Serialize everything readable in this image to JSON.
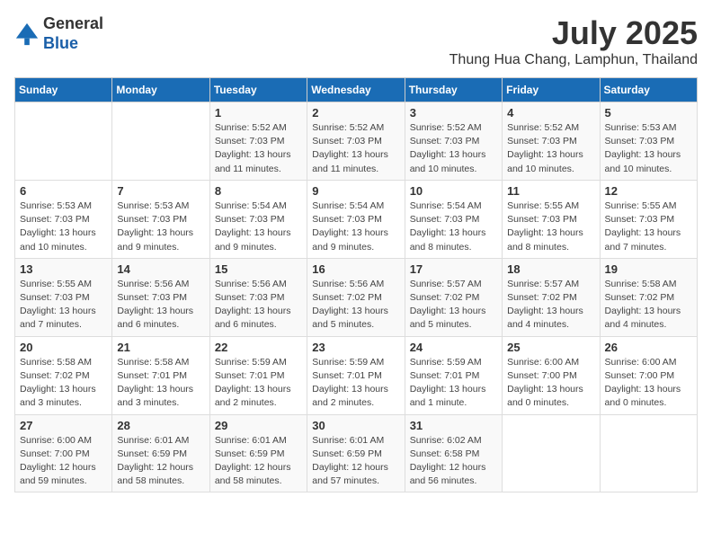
{
  "header": {
    "logo_line1": "General",
    "logo_line2": "Blue",
    "month_year": "July 2025",
    "location": "Thung Hua Chang, Lamphun, Thailand"
  },
  "weekdays": [
    "Sunday",
    "Monday",
    "Tuesday",
    "Wednesday",
    "Thursday",
    "Friday",
    "Saturday"
  ],
  "weeks": [
    [
      {
        "day": "",
        "sunrise": "",
        "sunset": "",
        "daylight": ""
      },
      {
        "day": "",
        "sunrise": "",
        "sunset": "",
        "daylight": ""
      },
      {
        "day": "1",
        "sunrise": "Sunrise: 5:52 AM",
        "sunset": "Sunset: 7:03 PM",
        "daylight": "Daylight: 13 hours and 11 minutes."
      },
      {
        "day": "2",
        "sunrise": "Sunrise: 5:52 AM",
        "sunset": "Sunset: 7:03 PM",
        "daylight": "Daylight: 13 hours and 11 minutes."
      },
      {
        "day": "3",
        "sunrise": "Sunrise: 5:52 AM",
        "sunset": "Sunset: 7:03 PM",
        "daylight": "Daylight: 13 hours and 10 minutes."
      },
      {
        "day": "4",
        "sunrise": "Sunrise: 5:52 AM",
        "sunset": "Sunset: 7:03 PM",
        "daylight": "Daylight: 13 hours and 10 minutes."
      },
      {
        "day": "5",
        "sunrise": "Sunrise: 5:53 AM",
        "sunset": "Sunset: 7:03 PM",
        "daylight": "Daylight: 13 hours and 10 minutes."
      }
    ],
    [
      {
        "day": "6",
        "sunrise": "Sunrise: 5:53 AM",
        "sunset": "Sunset: 7:03 PM",
        "daylight": "Daylight: 13 hours and 10 minutes."
      },
      {
        "day": "7",
        "sunrise": "Sunrise: 5:53 AM",
        "sunset": "Sunset: 7:03 PM",
        "daylight": "Daylight: 13 hours and 9 minutes."
      },
      {
        "day": "8",
        "sunrise": "Sunrise: 5:54 AM",
        "sunset": "Sunset: 7:03 PM",
        "daylight": "Daylight: 13 hours and 9 minutes."
      },
      {
        "day": "9",
        "sunrise": "Sunrise: 5:54 AM",
        "sunset": "Sunset: 7:03 PM",
        "daylight": "Daylight: 13 hours and 9 minutes."
      },
      {
        "day": "10",
        "sunrise": "Sunrise: 5:54 AM",
        "sunset": "Sunset: 7:03 PM",
        "daylight": "Daylight: 13 hours and 8 minutes."
      },
      {
        "day": "11",
        "sunrise": "Sunrise: 5:55 AM",
        "sunset": "Sunset: 7:03 PM",
        "daylight": "Daylight: 13 hours and 8 minutes."
      },
      {
        "day": "12",
        "sunrise": "Sunrise: 5:55 AM",
        "sunset": "Sunset: 7:03 PM",
        "daylight": "Daylight: 13 hours and 7 minutes."
      }
    ],
    [
      {
        "day": "13",
        "sunrise": "Sunrise: 5:55 AM",
        "sunset": "Sunset: 7:03 PM",
        "daylight": "Daylight: 13 hours and 7 minutes."
      },
      {
        "day": "14",
        "sunrise": "Sunrise: 5:56 AM",
        "sunset": "Sunset: 7:03 PM",
        "daylight": "Daylight: 13 hours and 6 minutes."
      },
      {
        "day": "15",
        "sunrise": "Sunrise: 5:56 AM",
        "sunset": "Sunset: 7:03 PM",
        "daylight": "Daylight: 13 hours and 6 minutes."
      },
      {
        "day": "16",
        "sunrise": "Sunrise: 5:56 AM",
        "sunset": "Sunset: 7:02 PM",
        "daylight": "Daylight: 13 hours and 5 minutes."
      },
      {
        "day": "17",
        "sunrise": "Sunrise: 5:57 AM",
        "sunset": "Sunset: 7:02 PM",
        "daylight": "Daylight: 13 hours and 5 minutes."
      },
      {
        "day": "18",
        "sunrise": "Sunrise: 5:57 AM",
        "sunset": "Sunset: 7:02 PM",
        "daylight": "Daylight: 13 hours and 4 minutes."
      },
      {
        "day": "19",
        "sunrise": "Sunrise: 5:58 AM",
        "sunset": "Sunset: 7:02 PM",
        "daylight": "Daylight: 13 hours and 4 minutes."
      }
    ],
    [
      {
        "day": "20",
        "sunrise": "Sunrise: 5:58 AM",
        "sunset": "Sunset: 7:02 PM",
        "daylight": "Daylight: 13 hours and 3 minutes."
      },
      {
        "day": "21",
        "sunrise": "Sunrise: 5:58 AM",
        "sunset": "Sunset: 7:01 PM",
        "daylight": "Daylight: 13 hours and 3 minutes."
      },
      {
        "day": "22",
        "sunrise": "Sunrise: 5:59 AM",
        "sunset": "Sunset: 7:01 PM",
        "daylight": "Daylight: 13 hours and 2 minutes."
      },
      {
        "day": "23",
        "sunrise": "Sunrise: 5:59 AM",
        "sunset": "Sunset: 7:01 PM",
        "daylight": "Daylight: 13 hours and 2 minutes."
      },
      {
        "day": "24",
        "sunrise": "Sunrise: 5:59 AM",
        "sunset": "Sunset: 7:01 PM",
        "daylight": "Daylight: 13 hours and 1 minute."
      },
      {
        "day": "25",
        "sunrise": "Sunrise: 6:00 AM",
        "sunset": "Sunset: 7:00 PM",
        "daylight": "Daylight: 13 hours and 0 minutes."
      },
      {
        "day": "26",
        "sunrise": "Sunrise: 6:00 AM",
        "sunset": "Sunset: 7:00 PM",
        "daylight": "Daylight: 13 hours and 0 minutes."
      }
    ],
    [
      {
        "day": "27",
        "sunrise": "Sunrise: 6:00 AM",
        "sunset": "Sunset: 7:00 PM",
        "daylight": "Daylight: 12 hours and 59 minutes."
      },
      {
        "day": "28",
        "sunrise": "Sunrise: 6:01 AM",
        "sunset": "Sunset: 6:59 PM",
        "daylight": "Daylight: 12 hours and 58 minutes."
      },
      {
        "day": "29",
        "sunrise": "Sunrise: 6:01 AM",
        "sunset": "Sunset: 6:59 PM",
        "daylight": "Daylight: 12 hours and 58 minutes."
      },
      {
        "day": "30",
        "sunrise": "Sunrise: 6:01 AM",
        "sunset": "Sunset: 6:59 PM",
        "daylight": "Daylight: 12 hours and 57 minutes."
      },
      {
        "day": "31",
        "sunrise": "Sunrise: 6:02 AM",
        "sunset": "Sunset: 6:58 PM",
        "daylight": "Daylight: 12 hours and 56 minutes."
      },
      {
        "day": "",
        "sunrise": "",
        "sunset": "",
        "daylight": ""
      },
      {
        "day": "",
        "sunrise": "",
        "sunset": "",
        "daylight": ""
      }
    ]
  ]
}
